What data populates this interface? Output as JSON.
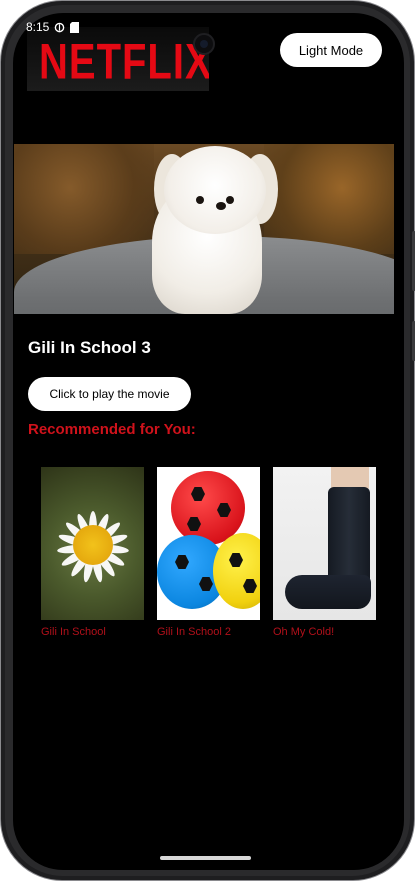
{
  "status_bar": {
    "time": "8:15"
  },
  "header": {
    "logo_text": "NETFLIX",
    "mode_button_label": "Light Mode"
  },
  "featured": {
    "title": "Gili In School 3",
    "play_button_label": "Click to play the movie"
  },
  "recommendations": {
    "heading": "Recommended for You:",
    "items": [
      {
        "title": "Gili In School"
      },
      {
        "title": "Gili In School 2"
      },
      {
        "title": "Oh My Cold!"
      }
    ]
  },
  "colors": {
    "background": "#000000",
    "brand_red": "#e50914",
    "heading_red": "#d0121b",
    "caption_red": "#b0101a",
    "button_bg": "#ffffff"
  }
}
